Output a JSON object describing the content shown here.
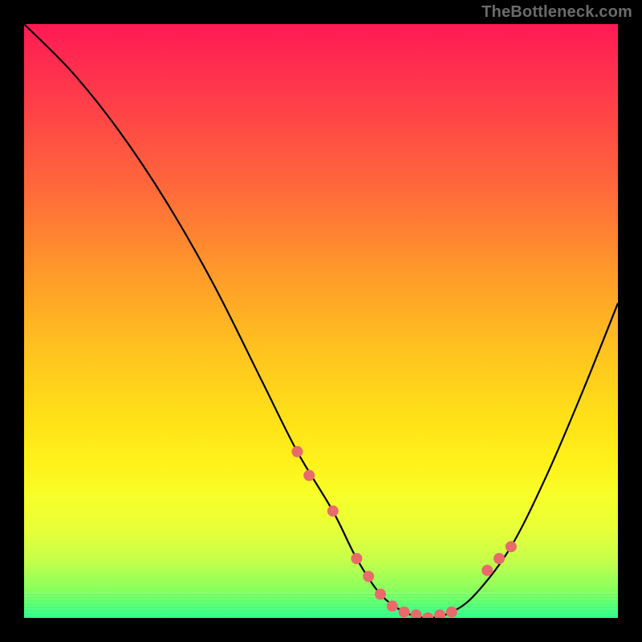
{
  "attribution": "TheBottleneck.com",
  "chart_data": {
    "type": "line",
    "title": "",
    "xlabel": "",
    "ylabel": "",
    "xlim": [
      0,
      100
    ],
    "ylim": [
      0,
      100
    ],
    "series": [
      {
        "name": "bottleneck-curve",
        "x": [
          0,
          8,
          16,
          24,
          32,
          40,
          46,
          52,
          56,
          60,
          64,
          68,
          72,
          76,
          82,
          88,
          94,
          100
        ],
        "y": [
          100,
          92,
          82,
          70,
          56,
          40,
          28,
          18,
          10,
          4,
          1,
          0,
          1,
          4,
          12,
          24,
          38,
          53
        ]
      }
    ],
    "markers": {
      "name": "highlight-dots",
      "color": "#e86a6a",
      "x": [
        46,
        48,
        52,
        56,
        58,
        60,
        62,
        64,
        66,
        68,
        70,
        72,
        78,
        80,
        82
      ],
      "y": [
        28,
        24,
        18,
        10,
        7,
        4,
        2,
        1,
        0.5,
        0,
        0.5,
        1,
        8,
        10,
        12
      ]
    },
    "gradient_stops": [
      {
        "pos": 0,
        "color": "#ff1a54"
      },
      {
        "pos": 12,
        "color": "#ff3b4b"
      },
      {
        "pos": 28,
        "color": "#ff6a3a"
      },
      {
        "pos": 42,
        "color": "#ff9a2a"
      },
      {
        "pos": 55,
        "color": "#ffc31f"
      },
      {
        "pos": 66,
        "color": "#ffe018"
      },
      {
        "pos": 74,
        "color": "#fff21a"
      },
      {
        "pos": 80,
        "color": "#f6ff2a"
      },
      {
        "pos": 85,
        "color": "#e8ff38"
      },
      {
        "pos": 90,
        "color": "#c8ff4a"
      },
      {
        "pos": 95,
        "color": "#8dff5c"
      },
      {
        "pos": 100,
        "color": "#2bff87"
      }
    ]
  }
}
